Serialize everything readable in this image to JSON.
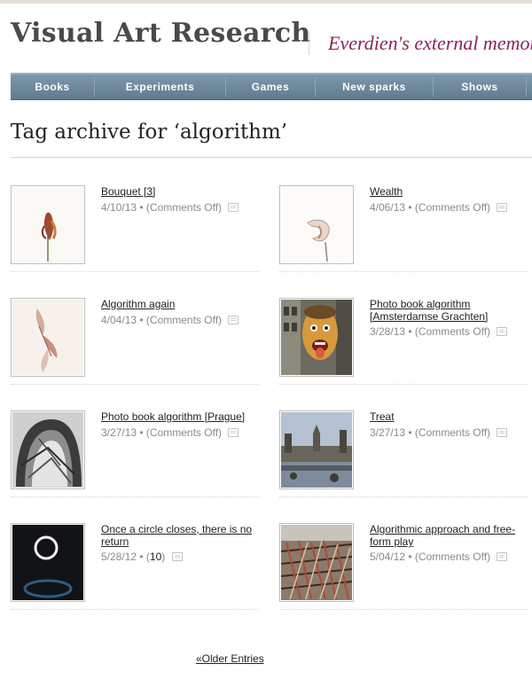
{
  "site": {
    "title": "Visual Art Research",
    "tagline": "Everdien's external memory"
  },
  "nav": [
    "Books",
    "Experiments",
    "Games",
    "New sparks",
    "Shows"
  ],
  "archive_title": "Tag archive for ‘algorithm’",
  "posts": [
    {
      "title": "Bouquet [3]",
      "date": "4/10/13",
      "comments": "(Comments Off)"
    },
    {
      "title": "Wealth",
      "date": "4/06/13",
      "comments": "(Comments Off)"
    },
    {
      "title": "Algorithm again",
      "date": "4/04/13",
      "comments": "(Comments Off)"
    },
    {
      "title": "Photo book algorithm [Amsterdamse Grachten]",
      "date": "3/28/13",
      "comments": "(Comments Off)"
    },
    {
      "title": "Photo book algorithm [Prague]",
      "date": "3/27/13",
      "comments": "(Comments Off)"
    },
    {
      "title": "Treat",
      "date": "3/27/13",
      "comments": "(Comments Off)"
    },
    {
      "title": "Once a circle closes, there is no return",
      "date": "5/28/12",
      "comments": "10"
    },
    {
      "title": "Algorithmic approach and free-form play",
      "date": "5/04/12",
      "comments": "(Comments Off)"
    }
  ],
  "older_entries": "«Older Entries",
  "colors": {
    "nav_bg": "#6f889b",
    "tagline": "#8c2358"
  }
}
